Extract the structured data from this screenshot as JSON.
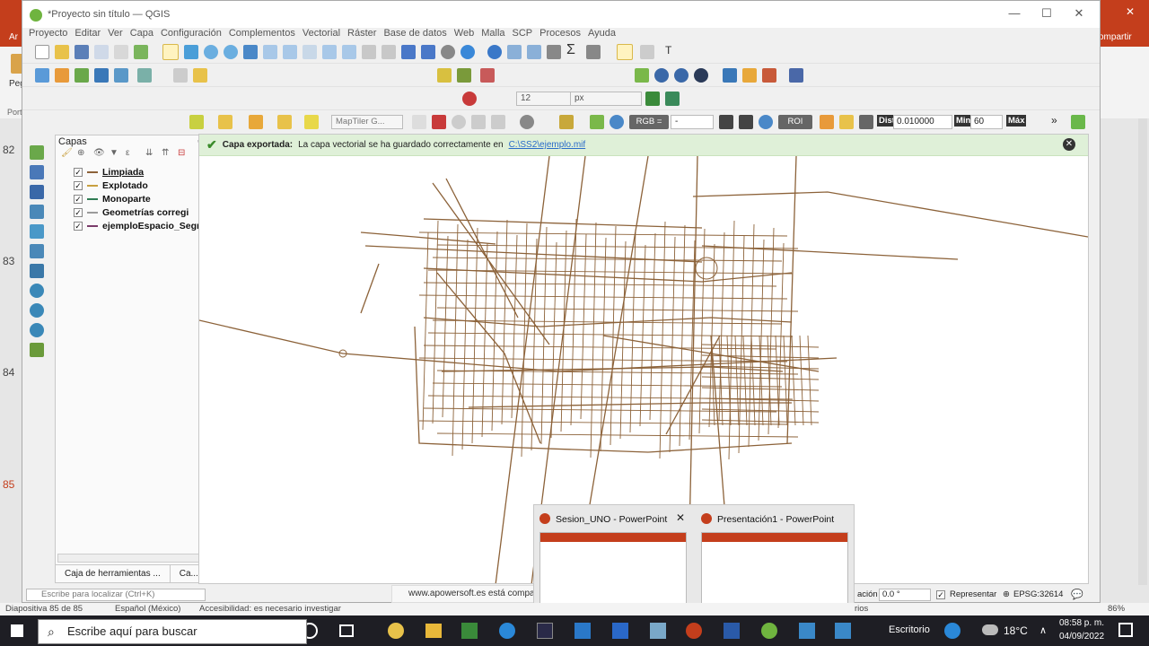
{
  "window": {
    "title": "*Proyecto sin título — QGIS"
  },
  "menu": [
    "Proyecto",
    "Editar",
    "Ver",
    "Capa",
    "Configuración",
    "Complementos",
    "Vectorial",
    "Ráster",
    "Base de datos",
    "Web",
    "Malla",
    "SCP",
    "Procesos",
    "Ayuda"
  ],
  "toolbar": {
    "size_value": "12",
    "size_unit": "px",
    "tile_placeholder": "MapTiler G...",
    "rgb_label": "RGB =",
    "rgb_value": "-",
    "roi_label": "ROI",
    "dist_label": "Dist",
    "dist_value": "0.010000",
    "min_label": "Min",
    "min_value": "60",
    "max_label": "Máx"
  },
  "layers_panel": {
    "title": "Capas",
    "layers": [
      {
        "name": "Limpiada",
        "checked": true,
        "color": "#8c6239",
        "underline": true
      },
      {
        "name": "Explotado",
        "checked": true,
        "color": "#c8a040"
      },
      {
        "name": "Monoparte",
        "checked": true,
        "color": "#2f7c53"
      },
      {
        "name": "Geometrías corregi",
        "checked": true,
        "color": "#9b9b9b"
      },
      {
        "name": "ejemploEspacio_Segm",
        "checked": true,
        "color": "#7a3b6a"
      }
    ],
    "tabs": [
      "Caja de herramientas ...",
      "Ca..."
    ]
  },
  "message_bar": {
    "bold": "Capa exportada:",
    "text": "La capa vectorial se ha guardado correctamente en",
    "link": "C:\\SS2\\ejemplo.mif"
  },
  "status": {
    "search_placeholder": "Escribe para localizar (Ctrl+K)",
    "rotation_label": "ación",
    "rotation_value": "0.0 °",
    "render_label": "Representar",
    "crs": "EPSG:32614"
  },
  "ppt": {
    "tab_fragment": "Ar",
    "right_button": "ompartir",
    "paste_label": "Peg",
    "portapapeles": "Port",
    "slide_numbers": [
      "82",
      "83",
      "84",
      "85"
    ],
    "status_slide": "Diapositiva 85 de 85",
    "status_lang": "Español (México)",
    "status_access": "Accesibilidad: es necesario investigar",
    "status_notes": "rios",
    "zoom": "86%"
  },
  "recording_banner": "www.apowersoft.es está compa",
  "thumbnails": [
    {
      "title": "Sesion_UNO - PowerPoint"
    },
    {
      "title": "Presentación1 - PowerPoint"
    }
  ],
  "taskbar": {
    "search_text": "Escribe aquí para buscar",
    "desktop_label": "Escritorio",
    "temperature": "18°C",
    "time": "08:58 p. m.",
    "date": "04/09/2022"
  },
  "colors": {
    "road": "#8c6239",
    "ppt_accent": "#c43e1c",
    "message_bg": "#dff0d8"
  }
}
